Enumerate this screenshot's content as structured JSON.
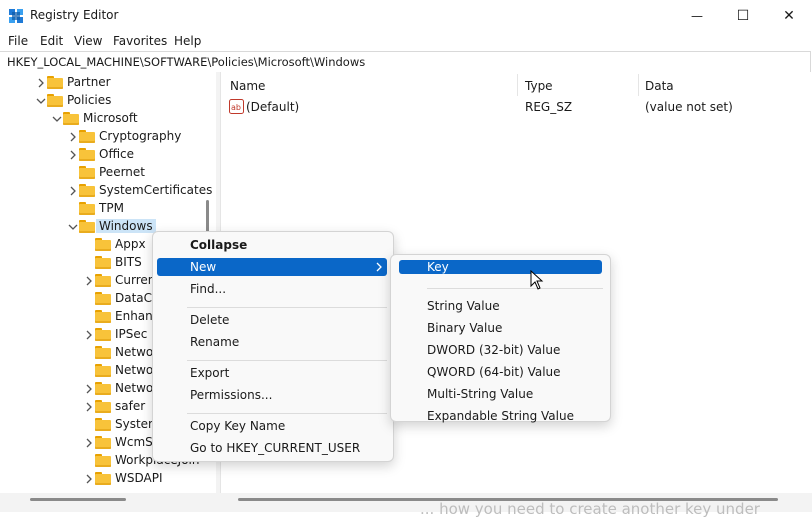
{
  "window": {
    "title": "Registry Editor",
    "controls": {
      "minimize": "—",
      "maximize": "☐",
      "close": "✕"
    }
  },
  "menu": [
    "File",
    "Edit",
    "View",
    "Favorites",
    "Help"
  ],
  "address": "HKEY_LOCAL_MACHINE\\SOFTWARE\\Policies\\Microsoft\\Windows",
  "tree": {
    "items": [
      {
        "label": "Partner",
        "depth": 1,
        "chevron": "right"
      },
      {
        "label": "Policies",
        "depth": 1,
        "chevron": "down"
      },
      {
        "label": "Microsoft",
        "depth": 2,
        "chevron": "down"
      },
      {
        "label": "Cryptography",
        "depth": 3,
        "chevron": "right"
      },
      {
        "label": "Office",
        "depth": 3,
        "chevron": "right"
      },
      {
        "label": "Peernet",
        "depth": 3,
        "chevron": "none"
      },
      {
        "label": "SystemCertificates",
        "depth": 3,
        "chevron": "right"
      },
      {
        "label": "TPM",
        "depth": 3,
        "chevron": "none"
      },
      {
        "label": "Windows",
        "depth": 3,
        "chevron": "down",
        "selected": true
      },
      {
        "label": "Appx",
        "depth": 4,
        "chevron": "none"
      },
      {
        "label": "BITS",
        "depth": 4,
        "chevron": "none"
      },
      {
        "label": "Curren",
        "depth": 4,
        "chevron": "right"
      },
      {
        "label": "DataCo",
        "depth": 4,
        "chevron": "none"
      },
      {
        "label": "Enhan",
        "depth": 4,
        "chevron": "none"
      },
      {
        "label": "IPSec",
        "depth": 4,
        "chevron": "right"
      },
      {
        "label": "Netwo",
        "depth": 4,
        "chevron": "none"
      },
      {
        "label": "Netwo",
        "depth": 4,
        "chevron": "none"
      },
      {
        "label": "Netwo",
        "depth": 4,
        "chevron": "right"
      },
      {
        "label": "safer",
        "depth": 4,
        "chevron": "right"
      },
      {
        "label": "System",
        "depth": 4,
        "chevron": "none"
      },
      {
        "label": "WcmS",
        "depth": 4,
        "chevron": "right"
      },
      {
        "label": "WorkplaceJoin",
        "depth": 4,
        "chevron": "none"
      },
      {
        "label": "WSDAPI",
        "depth": 4,
        "chevron": "right"
      }
    ]
  },
  "list": {
    "columns": [
      "Name",
      "Type",
      "Data"
    ],
    "rows": [
      {
        "name": "(Default)",
        "type": "REG_SZ",
        "data": "(value not set)",
        "icon": "ab-string-icon"
      }
    ]
  },
  "context_menu": {
    "items": [
      {
        "label": "Collapse",
        "bold": true
      },
      {
        "label": "New",
        "submenu": true,
        "highlighted": true
      },
      {
        "label": "Find..."
      },
      {
        "sep": true
      },
      {
        "label": "Delete"
      },
      {
        "label": "Rename"
      },
      {
        "sep": true
      },
      {
        "label": "Export"
      },
      {
        "label": "Permissions..."
      },
      {
        "sep": true
      },
      {
        "label": "Copy Key Name"
      },
      {
        "label": "Go to HKEY_CURRENT_USER"
      }
    ]
  },
  "submenu": {
    "items": [
      {
        "label": "Key",
        "highlighted": true
      },
      {
        "sep": true
      },
      {
        "label": "String Value"
      },
      {
        "label": "Binary Value"
      },
      {
        "label": "DWORD (32-bit) Value"
      },
      {
        "label": "QWORD (64-bit) Value"
      },
      {
        "label": "Multi-String Value"
      },
      {
        "label": "Expandable String Value"
      }
    ]
  },
  "background_text": "... how you need to create another key under",
  "colors": {
    "accent": "#0a67c8",
    "folder": "#f8c33a",
    "selection": "#cce4f7"
  }
}
